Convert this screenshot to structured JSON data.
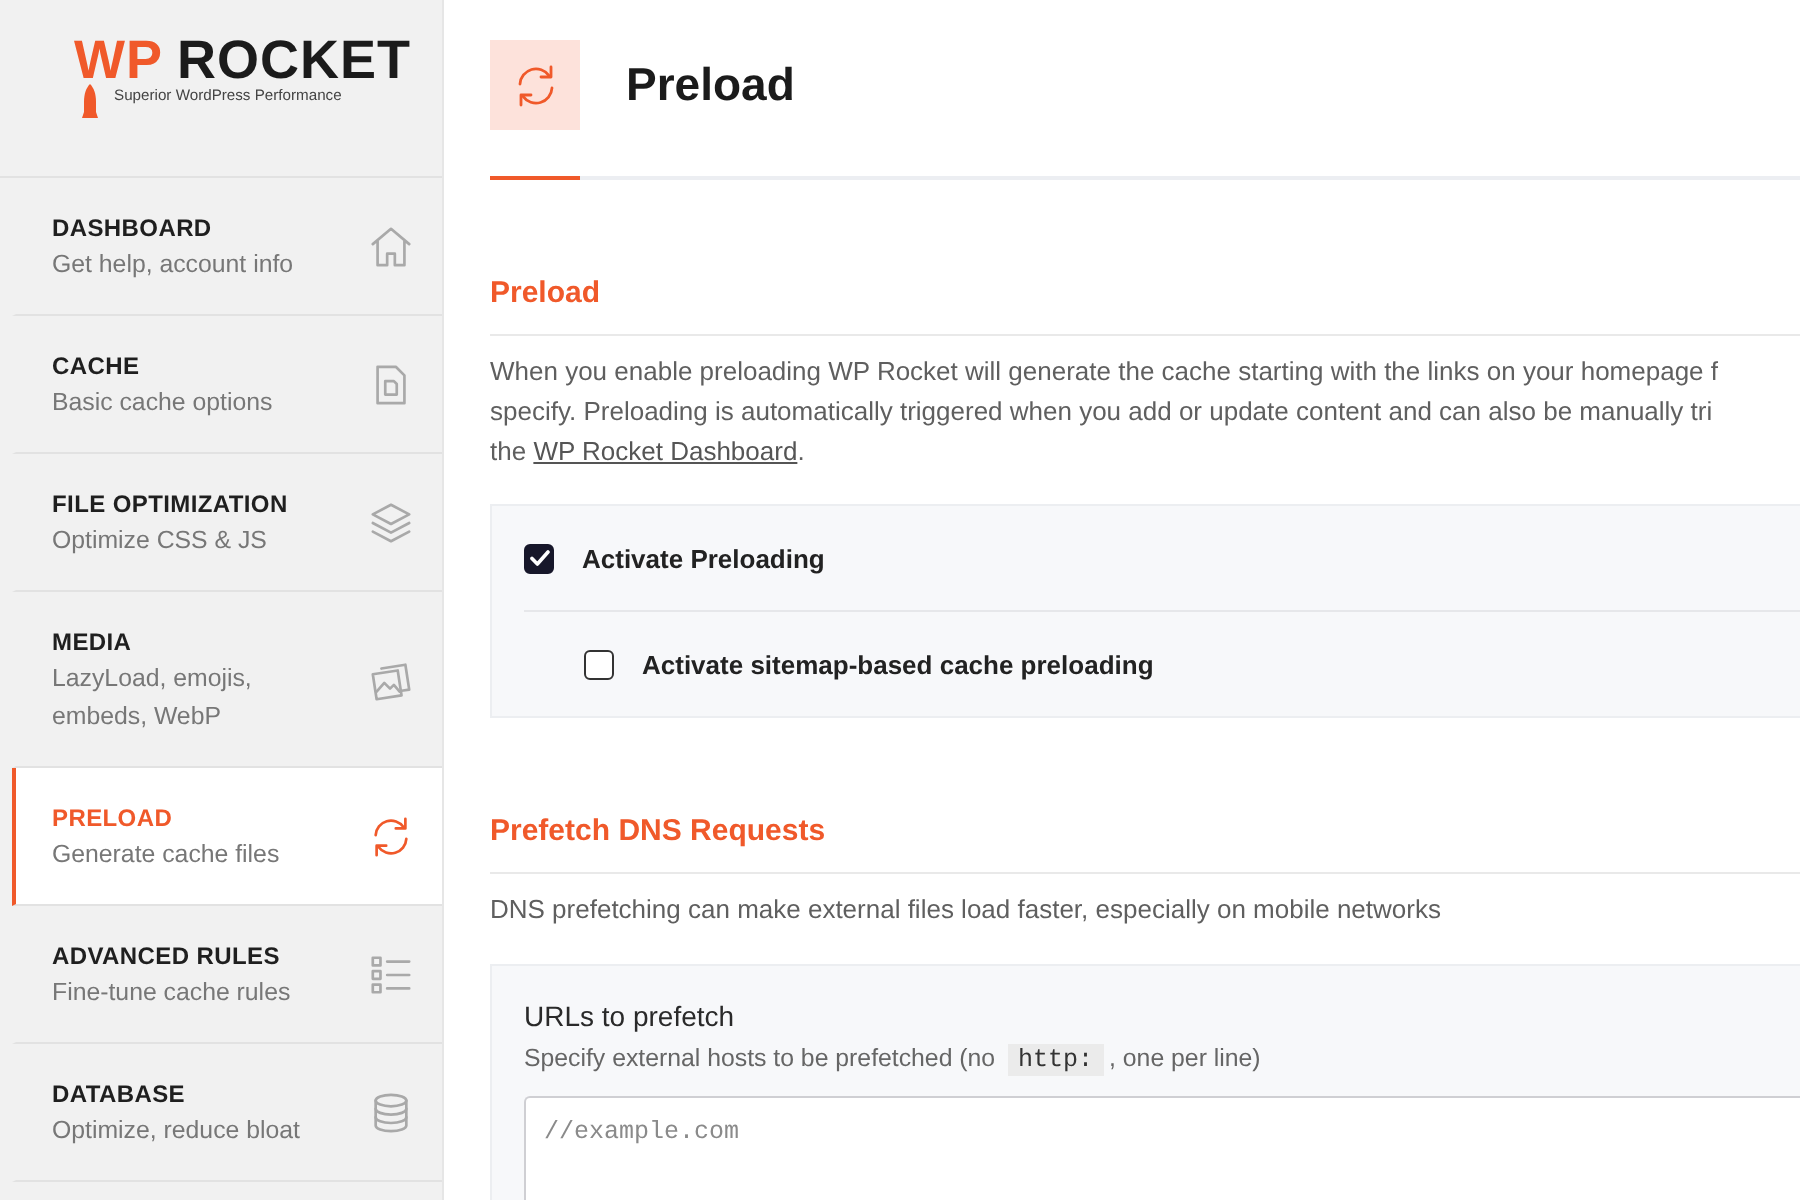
{
  "logo": {
    "accent": "WP",
    "name": "ROCKET",
    "tagline": "Superior WordPress Performance"
  },
  "sidebar": {
    "items": [
      {
        "kind": "dashboard",
        "title": "DASHBOARD",
        "subtitle": "Get help, account info",
        "selected": false
      },
      {
        "kind": "cache",
        "title": "CACHE",
        "subtitle": "Basic cache options",
        "selected": false
      },
      {
        "kind": "optimization",
        "title": "FILE OPTIMIZATION",
        "subtitle": "Optimize CSS & JS",
        "selected": false
      },
      {
        "kind": "media",
        "title": "MEDIA",
        "subtitle": "LazyLoad, emojis, embeds, WebP",
        "selected": false
      },
      {
        "kind": "preload",
        "title": "PRELOAD",
        "subtitle": "Generate cache files",
        "selected": true
      },
      {
        "kind": "rules",
        "title": "ADVANCED RULES",
        "subtitle": "Fine-tune cache rules",
        "selected": false
      },
      {
        "kind": "database",
        "title": "DATABASE",
        "subtitle": "Optimize, reduce bloat",
        "selected": false
      }
    ]
  },
  "header": {
    "title": "Preload"
  },
  "sections": [
    {
      "heading": "Preload",
      "description": {
        "lines": [
          "When you enable preloading WP Rocket will generate the cache starting with the links on your homepage f",
          "specify. Preloading is automatically triggered when you add or update content and can also be manually tri",
          "the "
        ],
        "link": "WP Rocket Dashboard",
        "after_link": "."
      },
      "options": [
        {
          "label": "Activate Preloading",
          "checked": true,
          "children": [
            {
              "label": "Activate sitemap-based cache preloading",
              "checked": false
            }
          ]
        }
      ]
    },
    {
      "heading": "Prefetch DNS Requests",
      "description": {
        "lines": [
          "DNS prefetching can make external files load faster, especially on mobile networks"
        ]
      },
      "field": {
        "label": "URLs to prefetch",
        "hint": {
          "before": "Specify external hosts to be prefetched (no ",
          "code": "http:",
          "after": ", one per line)"
        },
        "placeholder": "//example.com"
      }
    }
  ]
}
